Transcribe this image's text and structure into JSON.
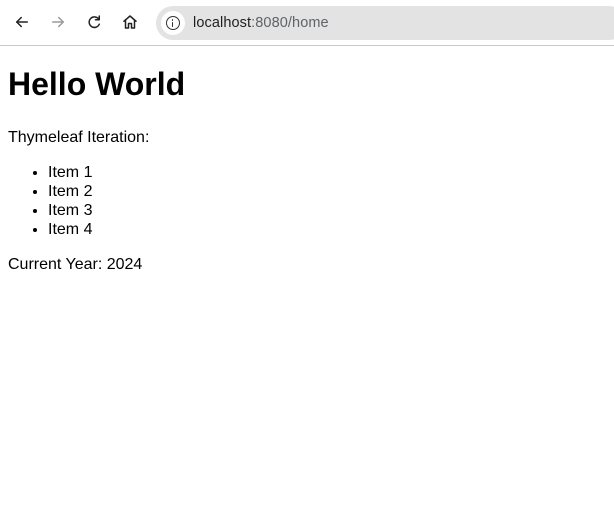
{
  "browser": {
    "url_host": "localhost",
    "url_path": ":8080/home",
    "icons": {
      "back": "arrow-left-icon",
      "forward": "arrow-right-icon",
      "reload": "reload-icon",
      "home": "home-icon",
      "site_info": "info-icon"
    }
  },
  "page": {
    "title": "Hello World",
    "iteration_label": "Thymeleaf Iteration:",
    "items": [
      "Item 1",
      "Item 2",
      "Item 3",
      "Item 4"
    ],
    "current_year": "Current Year: 2024"
  }
}
